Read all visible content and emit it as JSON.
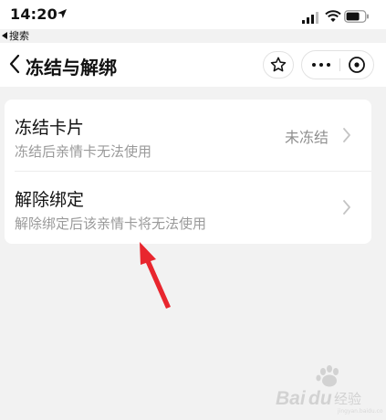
{
  "status_bar": {
    "time": "14:20",
    "icons": [
      "location-arrow-icon",
      "cellular-signal-icon",
      "wifi-icon",
      "battery-icon"
    ]
  },
  "back_app": {
    "label": "搜索"
  },
  "nav": {
    "title": "冻结与解绑",
    "icons": [
      "chevron-left-icon",
      "star-icon",
      "more-icon",
      "close-circle-icon"
    ]
  },
  "settings": {
    "items": [
      {
        "title": "冻结卡片",
        "subtitle": "冻结后亲情卡无法使用",
        "value": "未冻结"
      },
      {
        "title": "解除绑定",
        "subtitle": "解除绑定后该亲情卡将无法使用",
        "value": ""
      }
    ]
  },
  "colors": {
    "page_background": "#f2f2f2",
    "card_background": "#ffffff",
    "subtitle_text": "#9a9a9a",
    "annotation_arrow": "#e8262e"
  },
  "watermark": {
    "text": "Baidu经验",
    "brand": "Bai du"
  }
}
